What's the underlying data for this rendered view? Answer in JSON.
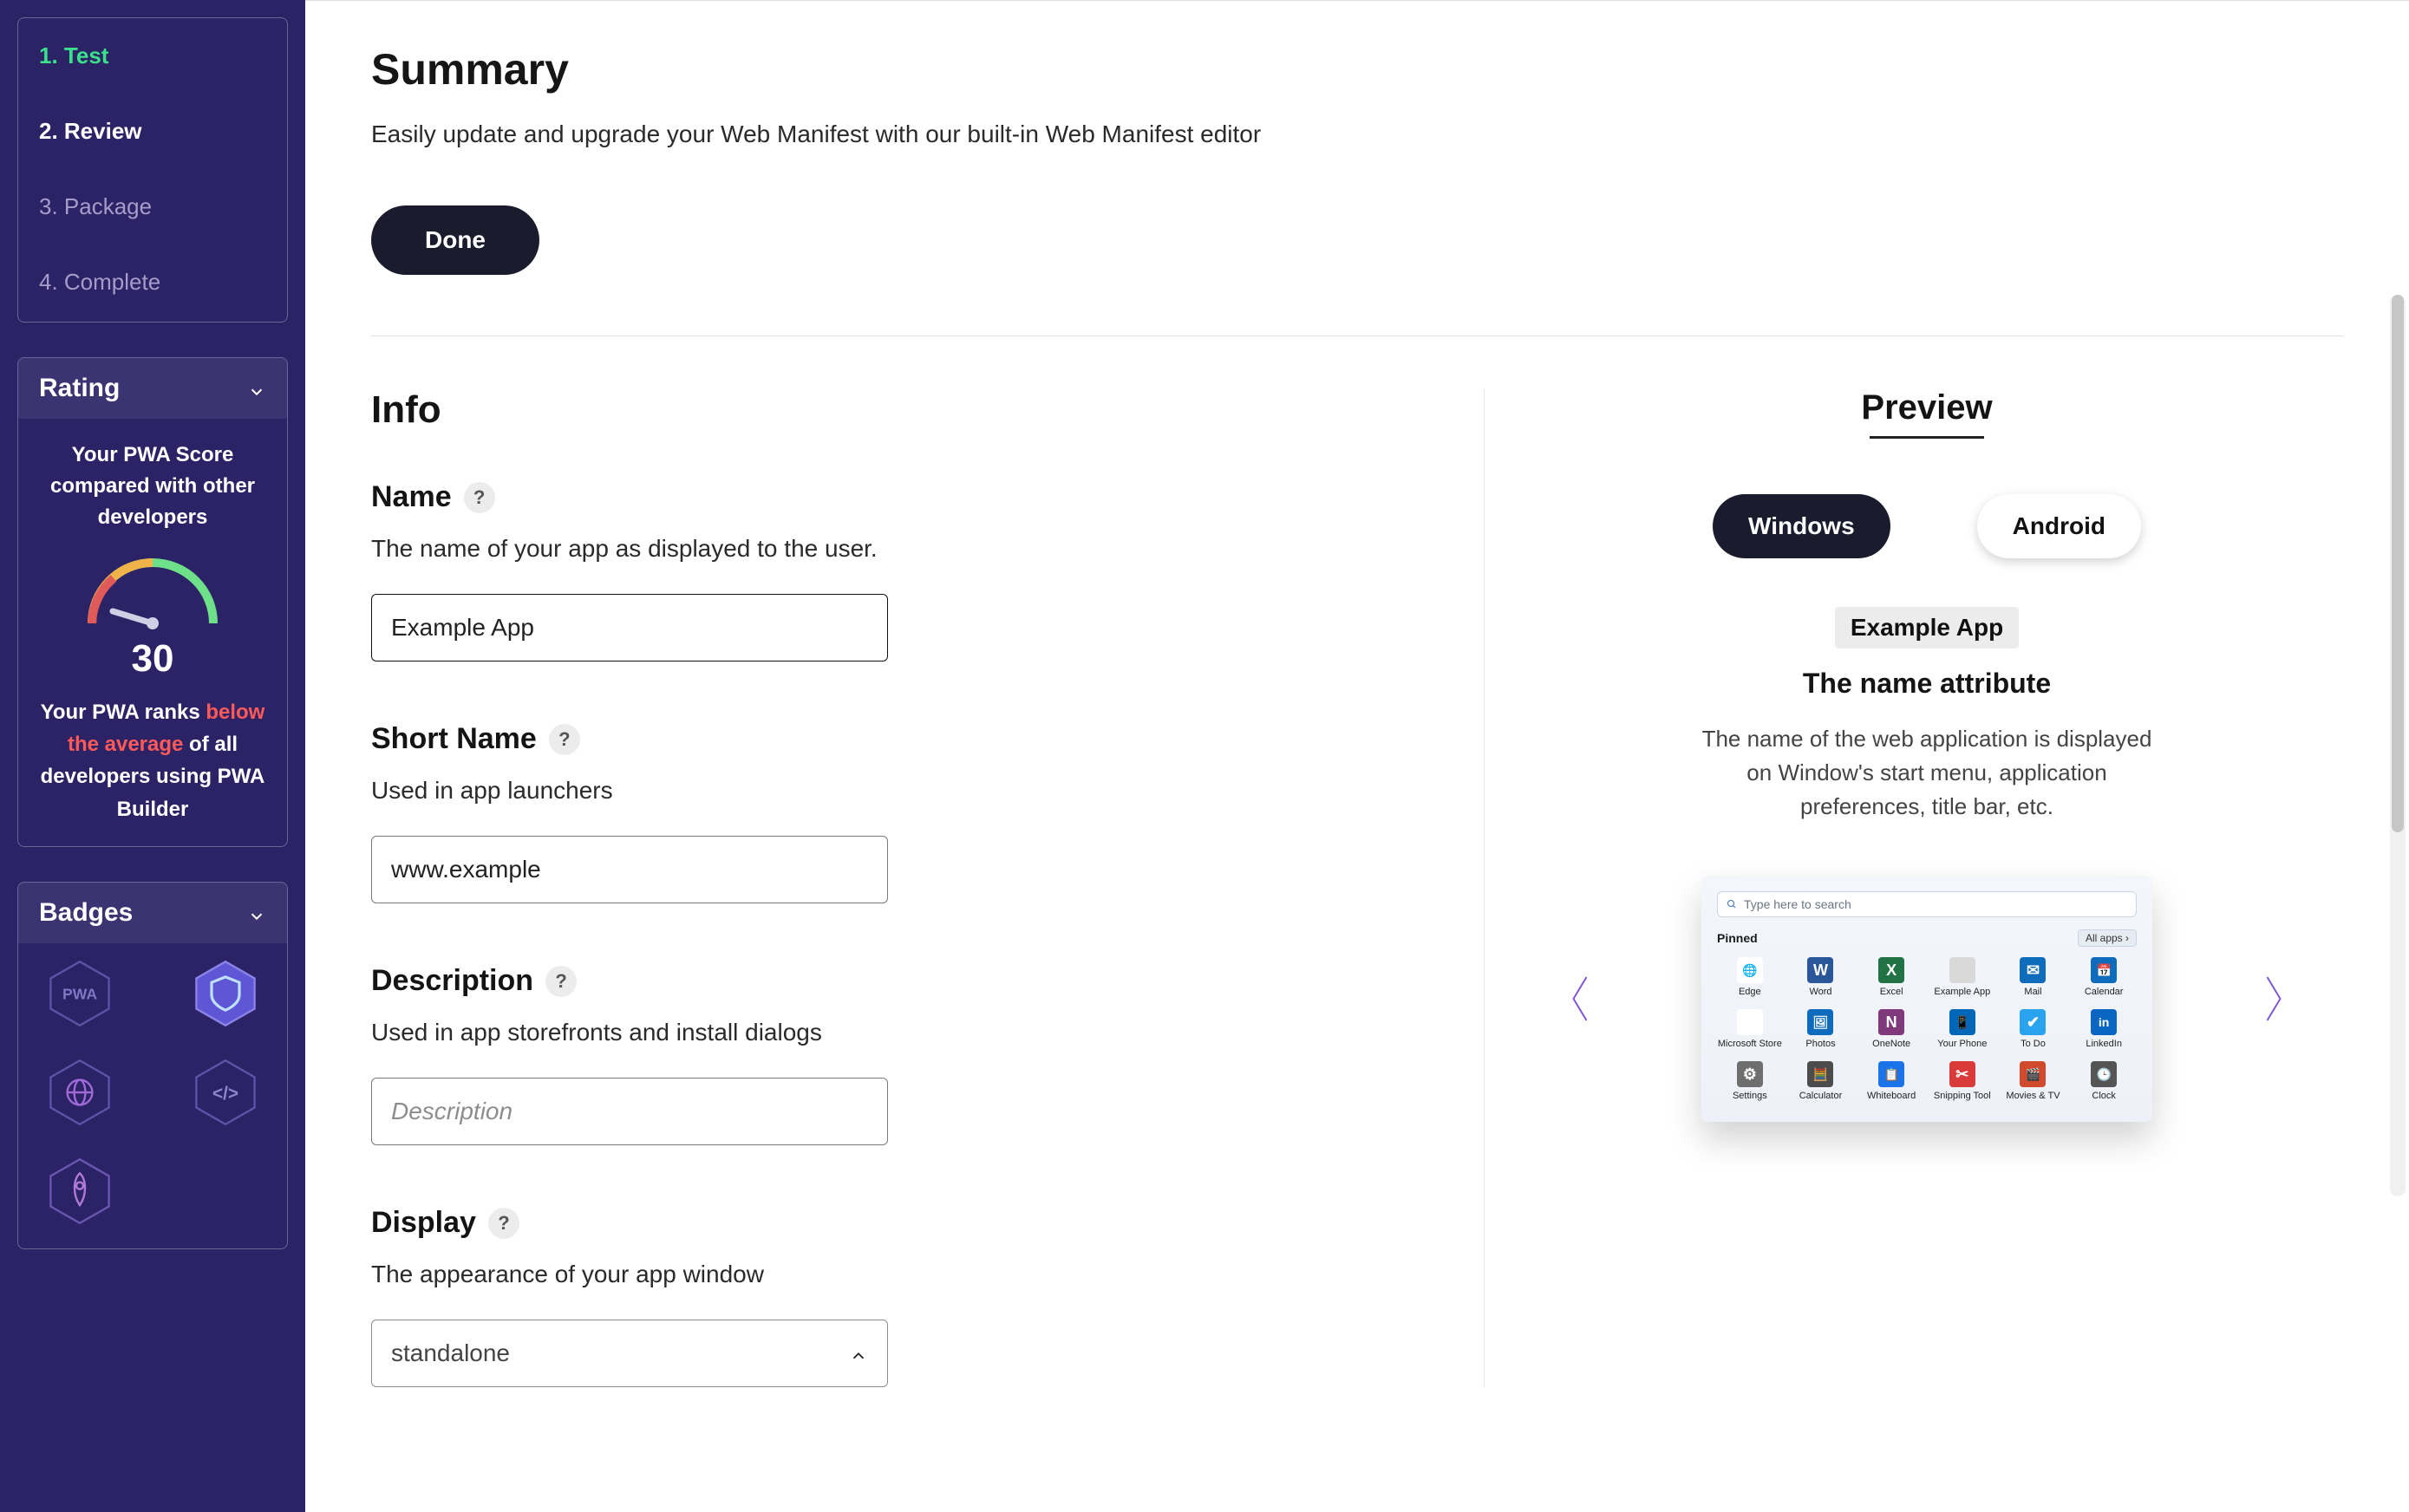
{
  "sidebar": {
    "steps": [
      {
        "label": "1. Test",
        "state": "done"
      },
      {
        "label": "2. Review",
        "state": "active"
      },
      {
        "label": "3. Package",
        "state": ""
      },
      {
        "label": "4. Complete",
        "state": ""
      }
    ],
    "rating": {
      "header": "Rating",
      "score_desc": "Your PWA Score compared with other developers",
      "score": "30",
      "rank_prefix": "Your PWA ranks ",
      "rank_highlight": "below the average",
      "rank_suffix": " of all developers using PWA Builder"
    },
    "badges": {
      "header": "Badges"
    }
  },
  "summary": {
    "title": "Summary",
    "subtitle": "Easily update and upgrade your Web Manifest with our built-in Web Manifest editor",
    "done_label": "Done"
  },
  "info": {
    "title": "Info",
    "fields": {
      "name": {
        "label": "Name",
        "desc": "The name of your app as displayed to the user.",
        "value": "Example App"
      },
      "short_name": {
        "label": "Short Name",
        "desc": "Used in app launchers",
        "value": "www.example"
      },
      "description": {
        "label": "Description",
        "desc": "Used in app storefronts and install dialogs",
        "placeholder": "Description"
      },
      "display": {
        "label": "Display",
        "desc": "The appearance of your app window",
        "value": "standalone"
      }
    }
  },
  "preview": {
    "title": "Preview",
    "tabs": {
      "windows": "Windows",
      "android": "Android"
    },
    "attr_badge": "Example App",
    "attr_title": "The name attribute",
    "attr_desc": "The name of the web application is displayed on Window's start menu, application preferences, title bar, etc.",
    "startmenu": {
      "search_placeholder": "Type here to search",
      "pinned_label": "Pinned",
      "all_apps_label": "All apps  ›",
      "apps": [
        {
          "label": "Edge",
          "icon": "🌐",
          "bg": "#ffffff"
        },
        {
          "label": "Word",
          "icon": "W",
          "bg": "#2b579a"
        },
        {
          "label": "Excel",
          "icon": "X",
          "bg": "#217346"
        },
        {
          "label": "Example App",
          "icon": "",
          "bg": "#d9d9d9"
        },
        {
          "label": "Mail",
          "icon": "✉",
          "bg": "#0f6cbd"
        },
        {
          "label": "Calendar",
          "icon": "📅",
          "bg": "#0f6cbd"
        },
        {
          "label": "Microsoft Store",
          "icon": "🛍",
          "bg": "#ffffff"
        },
        {
          "label": "Photos",
          "icon": "🖼",
          "bg": "#0f6cbd"
        },
        {
          "label": "OneNote",
          "icon": "N",
          "bg": "#80397b"
        },
        {
          "label": "Your Phone",
          "icon": "📱",
          "bg": "#0067b8"
        },
        {
          "label": "To Do",
          "icon": "✔",
          "bg": "#2aa3ef"
        },
        {
          "label": "LinkedIn",
          "icon": "in",
          "bg": "#0a66c2"
        },
        {
          "label": "Settings",
          "icon": "⚙",
          "bg": "#6e6e6e"
        },
        {
          "label": "Calculator",
          "icon": "🧮",
          "bg": "#4c4c4c"
        },
        {
          "label": "Whiteboard",
          "icon": "📋",
          "bg": "#1a73e8"
        },
        {
          "label": "Snipping Tool",
          "icon": "✂",
          "bg": "#d93a3a"
        },
        {
          "label": "Movies & TV",
          "icon": "🎬",
          "bg": "#d04a2b"
        },
        {
          "label": "Clock",
          "icon": "🕒",
          "bg": "#555555"
        }
      ]
    }
  }
}
